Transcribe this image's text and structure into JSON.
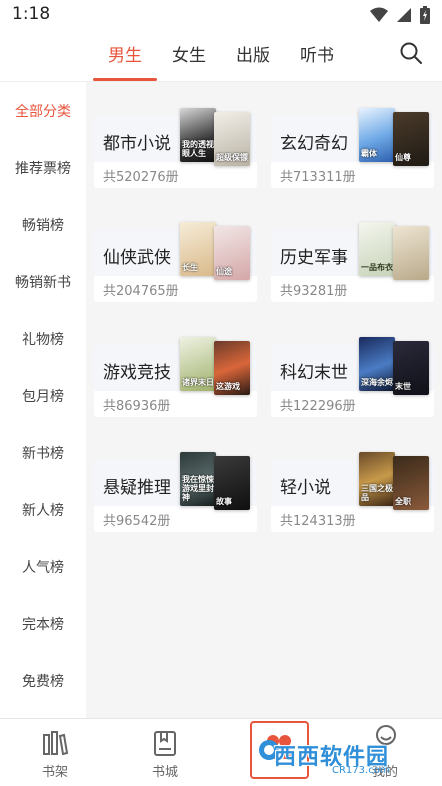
{
  "status_bar": {
    "time": "1:18"
  },
  "top_tabs": [
    {
      "label": "男生",
      "active": true
    },
    {
      "label": "女生",
      "active": false
    },
    {
      "label": "出版",
      "active": false
    },
    {
      "label": "听书",
      "active": false
    }
  ],
  "sidebar": [
    {
      "label": "全部分类",
      "active": true
    },
    {
      "label": "推荐票榜"
    },
    {
      "label": "畅销榜"
    },
    {
      "label": "畅销新书"
    },
    {
      "label": "礼物榜"
    },
    {
      "label": "包月榜"
    },
    {
      "label": "新书榜"
    },
    {
      "label": "新人榜"
    },
    {
      "label": "人气榜"
    },
    {
      "label": "完本榜"
    },
    {
      "label": "免费榜"
    }
  ],
  "categories": [
    {
      "title": "都市小说",
      "count": "共520276册",
      "cover_a_text": "我的透视眼人生",
      "cover_b_text": "超级保镖"
    },
    {
      "title": "玄幻奇幻",
      "count": "共713311册",
      "cover_a_text": "霸体",
      "cover_b_text": "仙尊"
    },
    {
      "title": "仙侠武侠",
      "count": "共204765册",
      "cover_a_text": "长生",
      "cover_b_text": "仙途"
    },
    {
      "title": "历史军事",
      "count": "共93281册",
      "cover_a_text": "一品布衣",
      "cover_b_text": ""
    },
    {
      "title": "游戏竞技",
      "count": "共86936册",
      "cover_a_text": "诸界末日",
      "cover_b_text": "这游戏"
    },
    {
      "title": "科幻末世",
      "count": "共122296册",
      "cover_a_text": "深海余烬",
      "cover_b_text": "末世"
    },
    {
      "title": "悬疑推理",
      "count": "共96542册",
      "cover_a_text": "我在惊悚游戏里封神",
      "cover_b_text": "故事"
    },
    {
      "title": "轻小说",
      "count": "共124313册",
      "cover_a_text": "三国之极品",
      "cover_b_text": "全职"
    }
  ],
  "bottom_nav": [
    {
      "label": "书架",
      "icon": "bookshelf-icon"
    },
    {
      "label": "书城",
      "icon": "bookstore-icon"
    },
    {
      "label": "",
      "icon": "category-icon",
      "active": true
    },
    {
      "label": "我的",
      "icon": "profile-icon"
    }
  ],
  "watermark": {
    "text": "西西软件园",
    "sub": "CR173.com"
  },
  "colors": {
    "accent": "#e8553d",
    "content_bg": "#f5f5f5",
    "card_top": "#f4f6fa"
  }
}
